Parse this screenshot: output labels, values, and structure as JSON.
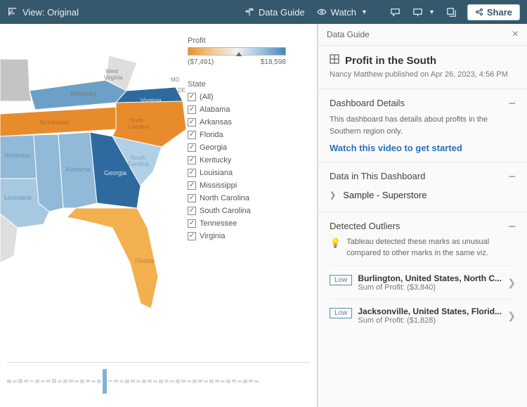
{
  "toolbar": {
    "view_label": "View: Original",
    "data_guide": "Data Guide",
    "watch": "Watch",
    "share": "Share"
  },
  "legend": {
    "title": "Profit",
    "min": "($7,491)",
    "max": "$18,598"
  },
  "filter": {
    "title": "State",
    "all": "(All)",
    "items": [
      "Alabama",
      "Arkansas",
      "Florida",
      "Georgia",
      "Kentucky",
      "Louisiana",
      "Mississippi",
      "North Carolina",
      "South Carolina",
      "Tennessee",
      "Virginia"
    ]
  },
  "panel": {
    "head": "Data Guide",
    "title": "Profit in the South",
    "byline": "Nancy Matthew published on Apr 26, 2023, 4:56 PM",
    "details": {
      "head": "Dashboard Details",
      "body": "This dashboard has details about profits in the Southern region only.",
      "link": "Watch this video to get started"
    },
    "data": {
      "head": "Data in This Dashboard",
      "source": "Sample - Superstore"
    },
    "outliers": {
      "head": "Detected Outliers",
      "desc": "Tableau detected these marks as unusual compared to other marks in the same viz.",
      "items": [
        {
          "badge": "Low",
          "title": "Burlington, United States, North C...",
          "sub": "Sum of Profit: ($3,840)"
        },
        {
          "badge": "Low",
          "title": "Jacksonville, United States, Florid...",
          "sub": "Sum of Profit: ($1,828)"
        }
      ]
    }
  }
}
